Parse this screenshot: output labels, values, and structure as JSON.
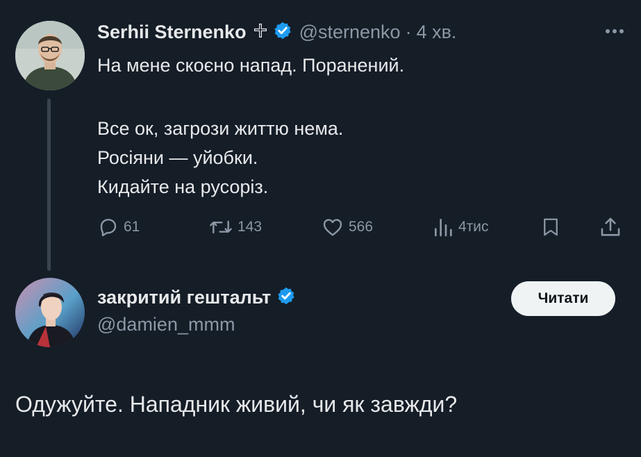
{
  "tweet": {
    "author": {
      "display_name": "Serhii Sternenko",
      "affiliation_badge": "cross-badge-icon",
      "verified": true,
      "handle": "@sternenko",
      "separator": "·",
      "time": "4 хв."
    },
    "text_lines": {
      "l1": "На мене скоєно напад. Поранений.",
      "l2": "Все ок, загрози життю нема.",
      "l3": "Росіяни — уйобки.",
      "l4": "Кидайте на русоріз."
    },
    "actions": {
      "replies": "61",
      "reposts": "143",
      "likes": "566",
      "views": "4тис"
    }
  },
  "reply": {
    "author": {
      "display_name": "закритий гештальт",
      "verified": true,
      "handle": "@damien_mmm"
    },
    "button_label": "Читати",
    "text": "Одужуйте. Нападник живий, чи як завжди?"
  },
  "colors": {
    "background": "#151d27",
    "text_primary": "#e7e9ea",
    "text_secondary": "#8b98a5",
    "verified_blue": "#1d9bf0",
    "button_bg": "#eff3f4"
  }
}
